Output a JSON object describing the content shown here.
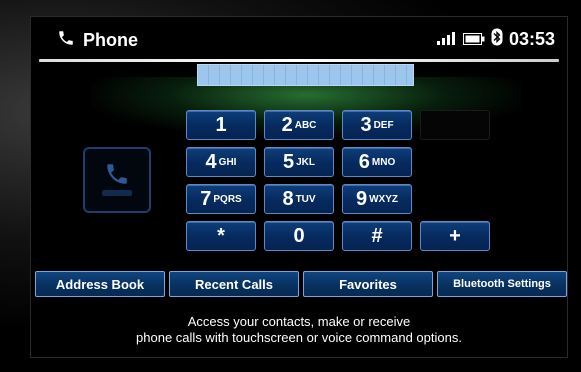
{
  "header": {
    "title": "Phone",
    "time": "03:53",
    "icons": [
      "phone-icon",
      "signal-icon",
      "battery-icon",
      "bluetooth-icon"
    ]
  },
  "keypad": {
    "keys": [
      {
        "digit": "1",
        "letters": ""
      },
      {
        "digit": "2",
        "letters": "ABC"
      },
      {
        "digit": "3",
        "letters": "DEF"
      },
      {
        "digit": "4",
        "letters": "GHI"
      },
      {
        "digit": "5",
        "letters": "JKL"
      },
      {
        "digit": "6",
        "letters": "MNO"
      },
      {
        "digit": "7",
        "letters": "PQRS"
      },
      {
        "digit": "8",
        "letters": "TUV"
      },
      {
        "digit": "9",
        "letters": "WXYZ"
      },
      {
        "digit": "*",
        "letters": ""
      },
      {
        "digit": "0",
        "letters": ""
      },
      {
        "digit": "#",
        "letters": ""
      },
      {
        "digit": "+",
        "letters": ""
      }
    ]
  },
  "tabs": [
    {
      "label": "Address Book"
    },
    {
      "label": "Recent Calls"
    },
    {
      "label": "Favorites"
    },
    {
      "label": "Bluetooth Settings"
    }
  ],
  "caption": {
    "line1": "Access your contacts, make or receive",
    "line2": "phone calls with touchscreen or voice command options."
  },
  "colors": {
    "button_fill": "#062a5e",
    "button_border": "#5f88c4",
    "field_fill": "#9cc6ec",
    "glow": "#46c85a"
  }
}
